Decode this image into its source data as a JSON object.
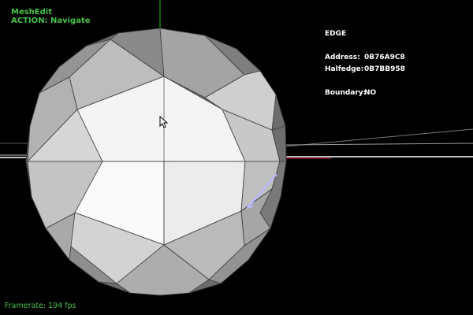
{
  "app": {
    "title": "MeshEdit",
    "action": "ACTION: Navigate"
  },
  "info_panel": {
    "heading": "EDGE",
    "address_label": "Address:",
    "address_value": "0B76A9C8",
    "halfedge_label": "Halfedge:",
    "halfedge_value": "0B7BB958",
    "boundary_label": "Boundary:",
    "boundary_value": "NO"
  },
  "status": {
    "framerate": "Framerate: 194 fps"
  },
  "colors": {
    "hud_green": "#49c24a",
    "hud_white": "#ffffff",
    "background": "#000000",
    "axis_green": "#22c022",
    "axis_red": "#cc2222",
    "selected_edge": "#b8b8ff"
  },
  "icons": {
    "cursor": "mouse-pointer-icon"
  }
}
